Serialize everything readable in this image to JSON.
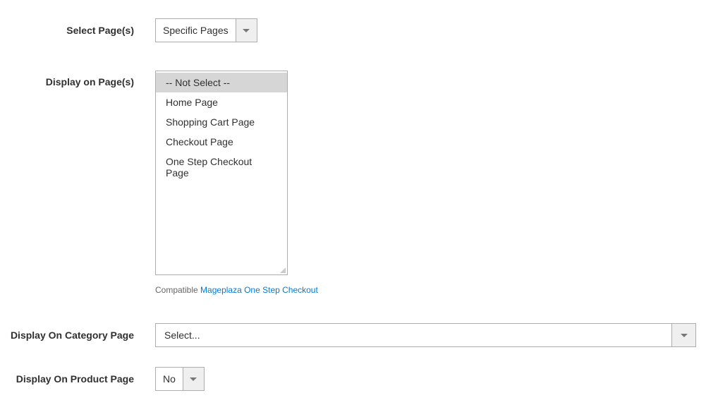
{
  "selectPages": {
    "label": "Select Page(s)",
    "value": "Specific Pages"
  },
  "displayOnPages": {
    "label": "Display on Page(s)",
    "options": [
      "-- Not Select --",
      "Home Page",
      "Shopping Cart Page",
      "Checkout Page",
      "One Step Checkout Page"
    ],
    "selectedIndex": 0,
    "helperText": "Compatible",
    "helperLinkText": "Mageplaza One Step Checkout"
  },
  "displayOnCategory": {
    "label": "Display On Category Page",
    "value": "Select..."
  },
  "displayOnProduct": {
    "label": "Display On Product Page",
    "value": "No"
  }
}
